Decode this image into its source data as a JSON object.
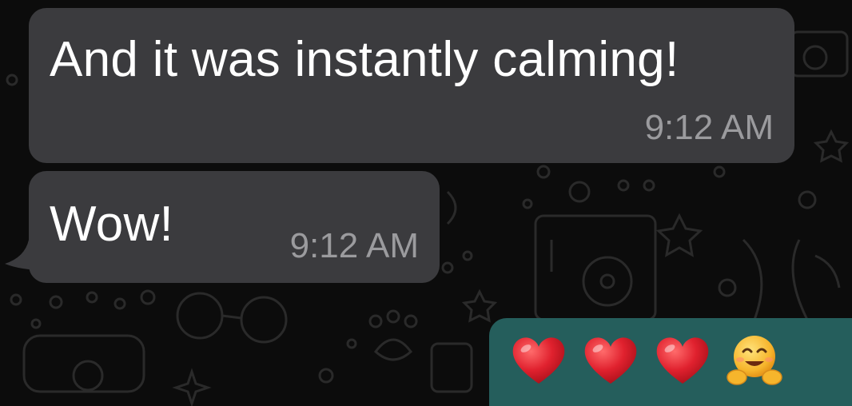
{
  "messages": [
    {
      "direction": "incoming",
      "text": "And it was instantly calming!",
      "time": "9:12 AM"
    },
    {
      "direction": "incoming",
      "text": "Wow!",
      "time": "9:12 AM"
    },
    {
      "direction": "outgoing",
      "emojis": [
        "red-heart",
        "red-heart",
        "red-heart",
        "hugging-face"
      ]
    }
  ],
  "colors": {
    "background": "#0c0c0c",
    "incoming_bubble": "#3b3b3e",
    "outgoing_bubble": "#255e5c",
    "timestamp": "#9b9b9e",
    "text": "#ffffff",
    "heart": "#e0212e",
    "hug_face": "#f6b52c"
  }
}
